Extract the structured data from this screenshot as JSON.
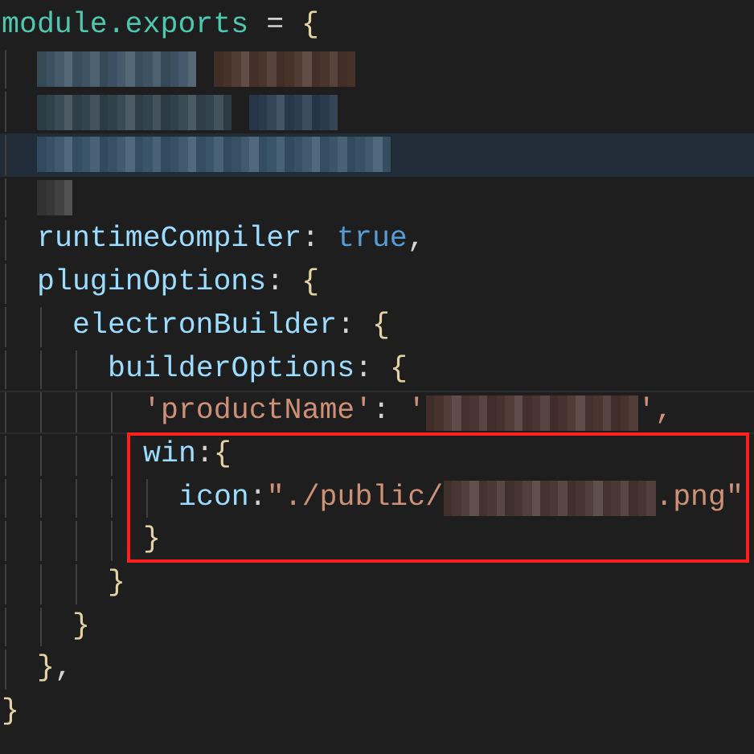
{
  "editor": {
    "lines": [
      {
        "tokens": [
          {
            "kind": "code",
            "text": "module.exports",
            "color": "#4ec9b0"
          },
          {
            "kind": "code",
            "text": " = ",
            "color": "#d4d4d4"
          },
          {
            "kind": "code",
            "text": "{",
            "color": "#e3d3a4"
          }
        ],
        "children": [
          {
            "tokens": [
              {
                "kind": "redacted",
                "color": "#3e5464"
              },
              {
                "kind": "redacted",
                "color": "#4a352c"
              }
            ]
          },
          {
            "tokens": [
              {
                "kind": "redacted",
                "color": "#34444f"
              },
              {
                "kind": "redacted",
                "color": "#2e3d52"
              }
            ]
          },
          {
            "highlighted": true,
            "tokens": [
              {
                "kind": "redacted",
                "color": "#3a5568"
              }
            ]
          },
          {
            "tokens": [
              {
                "kind": "redacted",
                "color": "#3a3a3a"
              }
            ]
          },
          {
            "tokens": [
              {
                "kind": "code",
                "text": "runtimeCompiler",
                "color": "#9cdcfe"
              },
              {
                "kind": "code",
                "text": ": ",
                "color": "#d4d4d4"
              },
              {
                "kind": "code",
                "text": "true",
                "color": "#569cd6"
              },
              {
                "kind": "code",
                "text": ",",
                "color": "#d4d4d4"
              }
            ]
          },
          {
            "tokens": [
              {
                "kind": "code",
                "text": "pluginOptions",
                "color": "#9cdcfe"
              },
              {
                "kind": "code",
                "text": ": ",
                "color": "#d4d4d4"
              },
              {
                "kind": "code",
                "text": "{",
                "color": "#e3d3a4"
              }
            ],
            "children": [
              {
                "tokens": [
                  {
                    "kind": "code",
                    "text": "electronBuilder",
                    "color": "#9cdcfe"
                  },
                  {
                    "kind": "code",
                    "text": ": ",
                    "color": "#d4d4d4"
                  },
                  {
                    "kind": "code",
                    "text": "{",
                    "color": "#e3d3a4"
                  }
                ],
                "children": [
                  {
                    "tokens": [
                      {
                        "kind": "code",
                        "text": "builderOptions",
                        "color": "#9cdcfe"
                      },
                      {
                        "kind": "code",
                        "text": ": ",
                        "color": "#d4d4d4"
                      },
                      {
                        "kind": "code",
                        "text": "{",
                        "color": "#e3d3a4"
                      }
                    ],
                    "children": [
                      {
                        "current_line": true,
                        "tokens": [
                          {
                            "kind": "code",
                            "text": "'productName'",
                            "color": "#ce9178"
                          },
                          {
                            "kind": "code",
                            "text": ": ",
                            "color": "#d4d4d4"
                          },
                          {
                            "kind": "code",
                            "text": "'",
                            "color": "#ce9178"
                          },
                          {
                            "kind": "redacted",
                            "color": "#4a3530"
                          },
                          {
                            "kind": "code",
                            "text": "',",
                            "color": "#ce9178"
                          }
                        ]
                      },
                      {
                        "boxed": true,
                        "tokens": [
                          {
                            "kind": "code",
                            "text": "win",
                            "color": "#9cdcfe"
                          },
                          {
                            "kind": "code",
                            "text": ":",
                            "color": "#d4d4d4"
                          },
                          {
                            "kind": "code",
                            "text": "{",
                            "color": "#e3d3a4"
                          }
                        ],
                        "children": [
                          {
                            "boxed": true,
                            "tokens": [
                              {
                                "kind": "code",
                                "text": "icon",
                                "color": "#9cdcfe"
                              },
                              {
                                "kind": "code",
                                "text": ":",
                                "color": "#d4d4d4"
                              },
                              {
                                "kind": "code",
                                "text": "\"./public/",
                                "color": "#ce9178"
                              },
                              {
                                "kind": "redacted",
                                "color": "#4a3833"
                              },
                              {
                                "kind": "code",
                                "text": ".png\"",
                                "color": "#ce9178"
                              }
                            ]
                          }
                        ]
                      },
                      {
                        "boxed": true,
                        "tokens": [
                          {
                            "kind": "code",
                            "text": "}",
                            "color": "#e3d3a4"
                          }
                        ]
                      }
                    ]
                  },
                  {
                    "tokens": [
                      {
                        "kind": "code",
                        "text": "}",
                        "color": "#e3d3a4"
                      }
                    ]
                  }
                ]
              },
              {
                "tokens": [
                  {
                    "kind": "code",
                    "text": "}",
                    "color": "#e3d3a4"
                  }
                ]
              }
            ]
          },
          {
            "tokens": [
              {
                "kind": "code",
                "text": "}",
                "color": "#e3d3a4"
              },
              {
                "kind": "code",
                "text": ",",
                "color": "#d4d4d4"
              }
            ]
          }
        ]
      },
      {
        "tokens": [
          {
            "kind": "code",
            "text": "}",
            "color": "#e3d3a4"
          }
        ]
      }
    ]
  }
}
